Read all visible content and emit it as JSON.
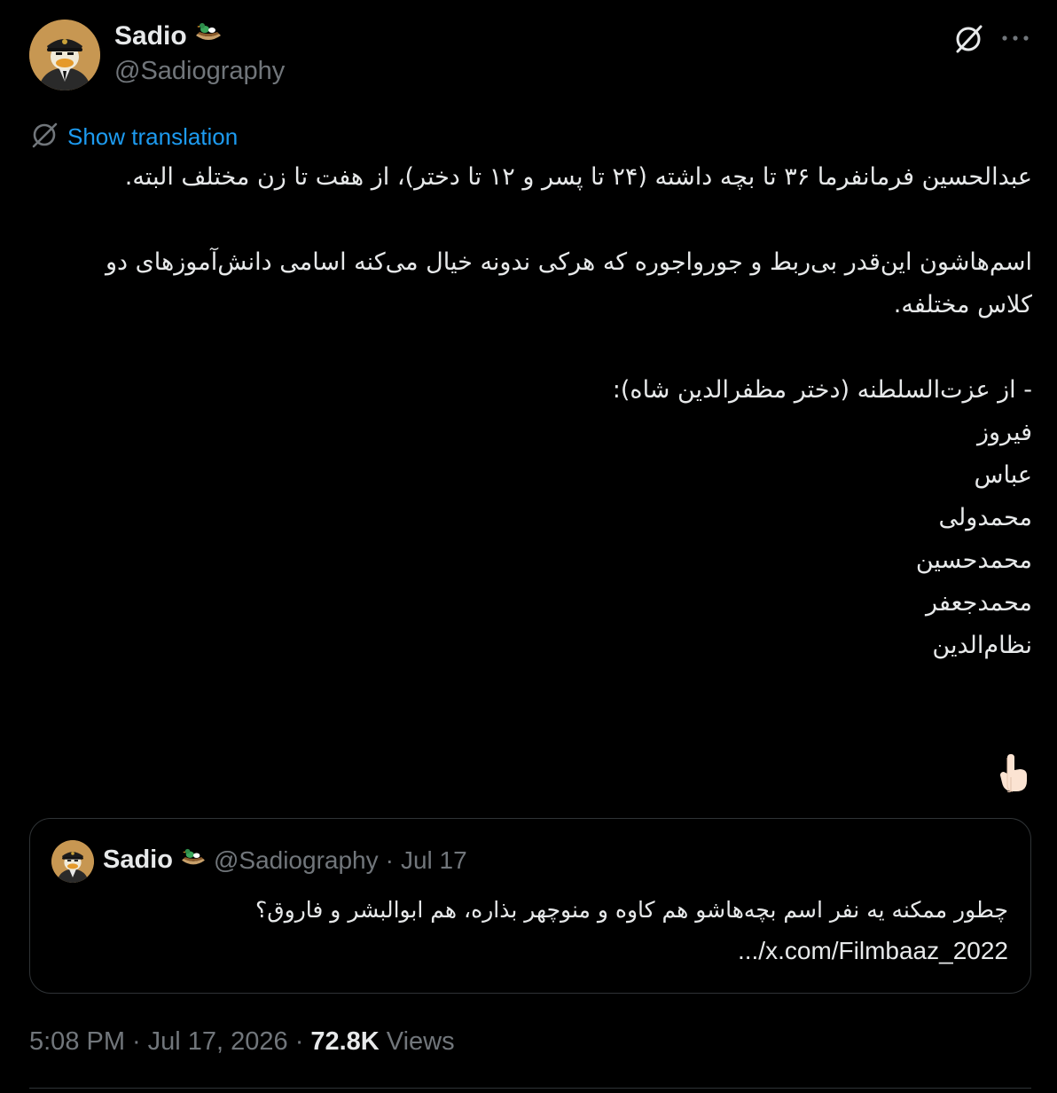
{
  "author": {
    "display_name": "Sadio",
    "badge_emoji": "🛶",
    "handle": "@Sadiography"
  },
  "header_icons": {
    "grok": "grok-icon",
    "more": "more-icon"
  },
  "translation": {
    "icon": "globe-icon",
    "label": "Show translation"
  },
  "tweet": {
    "text": "عبدالحسین فرمانفرما ۳۶ تا بچه داشته (۲۴ تا پسر و ۱۲ تا دختر)، از هفت تا زن مختلف البته.\n\nاسم‌هاشون این‌قدر بی‌ربط و جورواجوره که هرکی ندونه خیال می‌کنه اسامی دانش‌آموزهای دو کلاس مختلفه.\n\n- از عزت‌السلطنه (دختر مظفرالدین شاه):\nفیروز\nعباس\nمحمدولی\nمحمدحسین\nمحمدجعفر\nنظام‌الدین",
    "pointer_emoji": "👇🏻"
  },
  "quote": {
    "display_name": "Sadio",
    "badge_emoji": "🛶",
    "handle": "@Sadiography",
    "dot": "·",
    "date": "Jul 17",
    "text": "چطور ممکنه یه نفر اسم بچه‌هاشو هم کاوه و منوچهر بذاره، هم ابوالبشر و فاروق؟",
    "link": ".../x.com/Filmbaaz_2022"
  },
  "meta": {
    "time": "5:08 PM",
    "dot1": "·",
    "date": "Jul 17, 2026",
    "dot2": "·",
    "views_count": "72.8K",
    "views_label": "Views"
  },
  "colors": {
    "background": "#000000",
    "text": "#e7e9ea",
    "secondary": "#71767b",
    "link": "#1d9bf0",
    "border": "#2f3336"
  }
}
